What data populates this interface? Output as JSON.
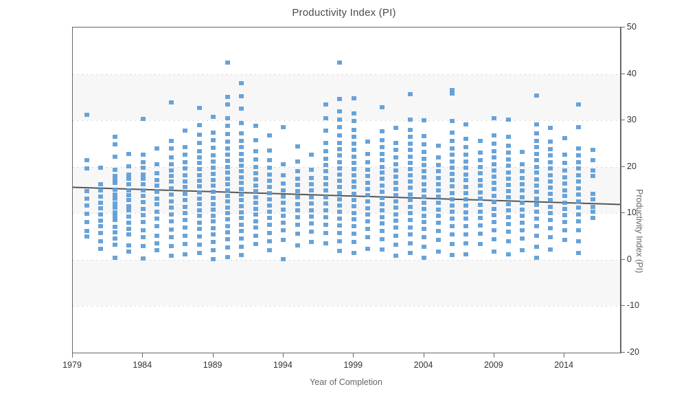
{
  "chart_data": {
    "type": "scatter",
    "title": "Productivity Index (PI)",
    "xlabel": "Year of Completion",
    "ylabel": "Productivity Index (PI)",
    "xlim": [
      1979,
      2018
    ],
    "ylim": [
      -20,
      50
    ],
    "x_ticks": [
      1979,
      1984,
      1989,
      1994,
      1999,
      2004,
      2009,
      2014
    ],
    "y_ticks": [
      50,
      40,
      30,
      20,
      10,
      0,
      -10,
      -20
    ],
    "grid": "horizontal-dotted",
    "legend": "none",
    "marker_color": "#5b9bd5",
    "marker_shape": "square",
    "band_color": "#f7f7f7",
    "banded_intervals": [
      [
        40,
        30
      ],
      [
        20,
        10
      ],
      [
        0,
        -10
      ]
    ],
    "trendline": {
      "type": "linear",
      "color": "#555555",
      "x_start": 1979,
      "y_start": 15.6,
      "x_end": 2018,
      "y_end": 11.9
    },
    "series": [
      {
        "name": "Projects",
        "points_by_year": {
          "1980": [
            31.2,
            21.4,
            19.6,
            14.8,
            13.2,
            11.7,
            9.9,
            8.1,
            6.2,
            5.0
          ],
          "1981": [
            19.8,
            16.2,
            15.0,
            13.6,
            12.2,
            11.1,
            9.8,
            8.4,
            7.3,
            5.8,
            4.0,
            2.3
          ],
          "1982": [
            26.5,
            24.8,
            22.2,
            19.4,
            18.0,
            17.2,
            16.5,
            15.1,
            14.0,
            13.2,
            12.1,
            11.3,
            10.2,
            9.4,
            8.5,
            7.1,
            5.9,
            4.6,
            3.2,
            0.4
          ],
          "1983": [
            22.8,
            20.1,
            18.3,
            17.4,
            16.2,
            15.0,
            13.9,
            12.8,
            11.5,
            10.6,
            9.3,
            8.0,
            6.7,
            5.4,
            3.1,
            1.7
          ],
          "1984": [
            30.3,
            22.6,
            21.0,
            19.8,
            18.4,
            17.5,
            16.2,
            15.0,
            13.8,
            12.4,
            11.0,
            9.6,
            8.1,
            6.4,
            4.9,
            3.0,
            0.3
          ],
          "1985": [
            24.0,
            20.5,
            18.6,
            17.1,
            15.9,
            14.6,
            13.2,
            12.0,
            10.4,
            8.8,
            7.2,
            5.1,
            3.5,
            2.0
          ],
          "1986": [
            33.8,
            25.6,
            23.9,
            22.0,
            20.6,
            19.2,
            18.1,
            16.8,
            15.4,
            14.0,
            12.6,
            11.2,
            9.8,
            8.2,
            6.5,
            4.8,
            2.9,
            0.9
          ],
          "1987": [
            27.8,
            24.2,
            22.6,
            21.0,
            19.6,
            18.2,
            16.9,
            15.6,
            14.2,
            12.9,
            11.4,
            10.0,
            8.5,
            6.9,
            5.2,
            3.4,
            1.2
          ],
          "1988": [
            32.7,
            29.0,
            26.9,
            25.2,
            23.4,
            22.0,
            20.8,
            19.5,
            18.2,
            17.0,
            15.8,
            14.5,
            13.2,
            12.0,
            10.7,
            9.4,
            8.0,
            6.6,
            5.0,
            3.3,
            1.4
          ],
          "1989": [
            30.8,
            27.4,
            25.8,
            24.1,
            22.5,
            21.2,
            19.8,
            18.5,
            17.2,
            15.9,
            14.6,
            13.3,
            12.0,
            10.8,
            9.5,
            8.2,
            6.8,
            5.4,
            3.8,
            2.1,
            0.2
          ],
          "1990": [
            42.5,
            35.0,
            33.4,
            30.5,
            28.8,
            27.0,
            25.5,
            24.0,
            22.6,
            21.3,
            20.0,
            18.8,
            17.5,
            16.2,
            15.0,
            13.8,
            12.5,
            11.3,
            10.0,
            8.7,
            7.3,
            5.9,
            4.4,
            2.6,
            0.6
          ],
          "1991": [
            38.0,
            35.2,
            32.5,
            29.5,
            27.2,
            25.6,
            24.2,
            22.8,
            21.4,
            20.2,
            19.0,
            17.8,
            16.5,
            15.2,
            14.0,
            12.8,
            11.5,
            10.2,
            9.0,
            7.6,
            6.2,
            4.6,
            2.8,
            1.0
          ],
          "1992": [
            28.9,
            25.8,
            23.4,
            21.6,
            20.0,
            18.6,
            17.3,
            16.0,
            14.8,
            13.5,
            12.2,
            11.0,
            9.7,
            8.3,
            6.9,
            5.2,
            3.4
          ],
          "1993": [
            26.8,
            23.5,
            21.4,
            19.8,
            18.4,
            17.0,
            15.7,
            14.4,
            13.0,
            11.7,
            10.4,
            9.0,
            7.5,
            5.8,
            4.0,
            2.0
          ],
          "1994": [
            28.6,
            20.5,
            18.2,
            16.4,
            15.0,
            13.6,
            12.2,
            10.8,
            9.4,
            8.0,
            6.4,
            4.2,
            0.2
          ],
          "1995": [
            24.4,
            21.2,
            19.0,
            17.5,
            16.1,
            14.8,
            13.4,
            12.0,
            10.6,
            9.2,
            7.6,
            5.6,
            3.1
          ],
          "1996": [
            22.6,
            19.4,
            17.6,
            16.2,
            14.9,
            13.5,
            12.1,
            10.7,
            9.3,
            7.8,
            6.0,
            3.9
          ],
          "1997": [
            33.4,
            30.5,
            27.8,
            25.2,
            23.4,
            21.8,
            20.4,
            19.0,
            17.6,
            16.2,
            14.9,
            13.5,
            12.1,
            10.7,
            9.2,
            7.6,
            5.8,
            3.5
          ],
          "1998": [
            42.5,
            34.6,
            32.0,
            30.2,
            28.5,
            26.8,
            25.2,
            23.8,
            22.4,
            21.0,
            19.6,
            18.3,
            17.0,
            15.7,
            14.4,
            13.0,
            11.7,
            10.3,
            8.9,
            7.4,
            5.8,
            4.0,
            1.9
          ],
          "1999": [
            34.8,
            31.5,
            29.8,
            28.0,
            26.4,
            25.0,
            23.6,
            22.2,
            20.9,
            19.5,
            18.2,
            16.9,
            15.6,
            14.2,
            12.9,
            11.5,
            10.1,
            8.7,
            7.2,
            5.6,
            3.8,
            1.5
          ],
          "2000": [
            25.4,
            22.8,
            21.0,
            19.4,
            18.0,
            16.6,
            15.2,
            13.9,
            12.5,
            11.1,
            9.7,
            8.2,
            6.6,
            4.8,
            2.4
          ],
          "2001": [
            32.8,
            27.6,
            25.8,
            24.2,
            22.8,
            21.4,
            20.0,
            18.7,
            17.4,
            16.0,
            14.7,
            13.3,
            12.0,
            10.6,
            9.2,
            7.8,
            6.2,
            4.4,
            2.2
          ],
          "2002": [
            28.4,
            25.2,
            23.6,
            22.0,
            20.6,
            19.2,
            17.9,
            16.6,
            15.2,
            13.9,
            12.5,
            11.2,
            9.8,
            8.4,
            6.9,
            5.2,
            3.2,
            0.8
          ],
          "2003": [
            35.6,
            30.2,
            28.0,
            26.4,
            25.0,
            23.6,
            22.2,
            20.9,
            19.5,
            18.2,
            16.8,
            15.5,
            14.1,
            12.8,
            11.4,
            10.0,
            8.6,
            7.0,
            5.4,
            3.6,
            1.4
          ],
          "2004": [
            30.0,
            26.6,
            24.8,
            23.2,
            21.8,
            20.4,
            19.0,
            17.7,
            16.3,
            15.0,
            13.6,
            12.3,
            10.9,
            9.5,
            8.1,
            6.6,
            4.9,
            2.8,
            0.4
          ],
          "2005": [
            24.6,
            22.0,
            20.4,
            19.0,
            17.6,
            16.3,
            14.9,
            13.6,
            12.2,
            10.8,
            9.4,
            7.9,
            6.2,
            4.2,
            1.8
          ],
          "2006": [
            36.5,
            35.8,
            29.8,
            27.4,
            25.6,
            24.0,
            22.6,
            21.2,
            19.8,
            18.5,
            17.1,
            15.8,
            14.4,
            13.0,
            11.7,
            10.3,
            8.8,
            7.2,
            5.5,
            3.4,
            1.0
          ],
          "2007": [
            29.2,
            26.0,
            24.2,
            22.6,
            21.2,
            19.8,
            18.4,
            17.1,
            15.7,
            14.4,
            13.0,
            11.6,
            10.2,
            8.8,
            7.2,
            5.5,
            3.5,
            1.2
          ],
          "2008": [
            25.6,
            23.0,
            21.4,
            20.0,
            18.6,
            17.2,
            15.9,
            14.5,
            13.2,
            11.8,
            10.4,
            9.0,
            7.4,
            5.6,
            3.4
          ],
          "2009": [
            30.4,
            26.8,
            25.0,
            23.4,
            22.0,
            20.6,
            19.2,
            17.9,
            16.5,
            15.2,
            13.8,
            12.4,
            11.0,
            9.6,
            8.1,
            6.4,
            4.4,
            1.8
          ],
          "2010": [
            30.2,
            26.4,
            24.6,
            23.0,
            21.6,
            20.2,
            18.8,
            17.5,
            16.1,
            14.8,
            13.4,
            12.0,
            10.6,
            9.2,
            7.7,
            6.0,
            4.0,
            1.2
          ],
          "2011": [
            23.2,
            20.6,
            19.0,
            17.6,
            16.2,
            14.9,
            13.5,
            12.2,
            10.8,
            9.4,
            8.0,
            6.4,
            4.6,
            2.0
          ],
          "2012": [
            35.4,
            29.2,
            27.2,
            25.6,
            24.2,
            22.8,
            21.4,
            20.0,
            18.7,
            17.3,
            16.0,
            14.6,
            13.2,
            11.8,
            10.4,
            8.9,
            7.2,
            5.2,
            2.8,
            0.4
          ],
          "2013": [
            28.4,
            25.4,
            23.8,
            22.4,
            21.0,
            19.6,
            18.2,
            16.9,
            15.5,
            14.2,
            12.8,
            11.4,
            10.0,
            8.5,
            6.8,
            4.8,
            2.2
          ],
          "2014": [
            26.2,
            22.6,
            20.8,
            19.2,
            17.8,
            16.4,
            15.0,
            13.7,
            12.3,
            11.0,
            9.6,
            8.1,
            6.4,
            4.2
          ],
          "2015": [
            33.4,
            28.6,
            24.0,
            22.4,
            21.0,
            19.6,
            18.2,
            16.8,
            15.4,
            14.0,
            12.6,
            11.2,
            9.8,
            8.2,
            6.4,
            4.0,
            1.4
          ],
          "2016": [
            23.6,
            21.4,
            19.2,
            18.0,
            14.2,
            13.0,
            11.4,
            10.4,
            9.0
          ]
        }
      }
    ]
  }
}
